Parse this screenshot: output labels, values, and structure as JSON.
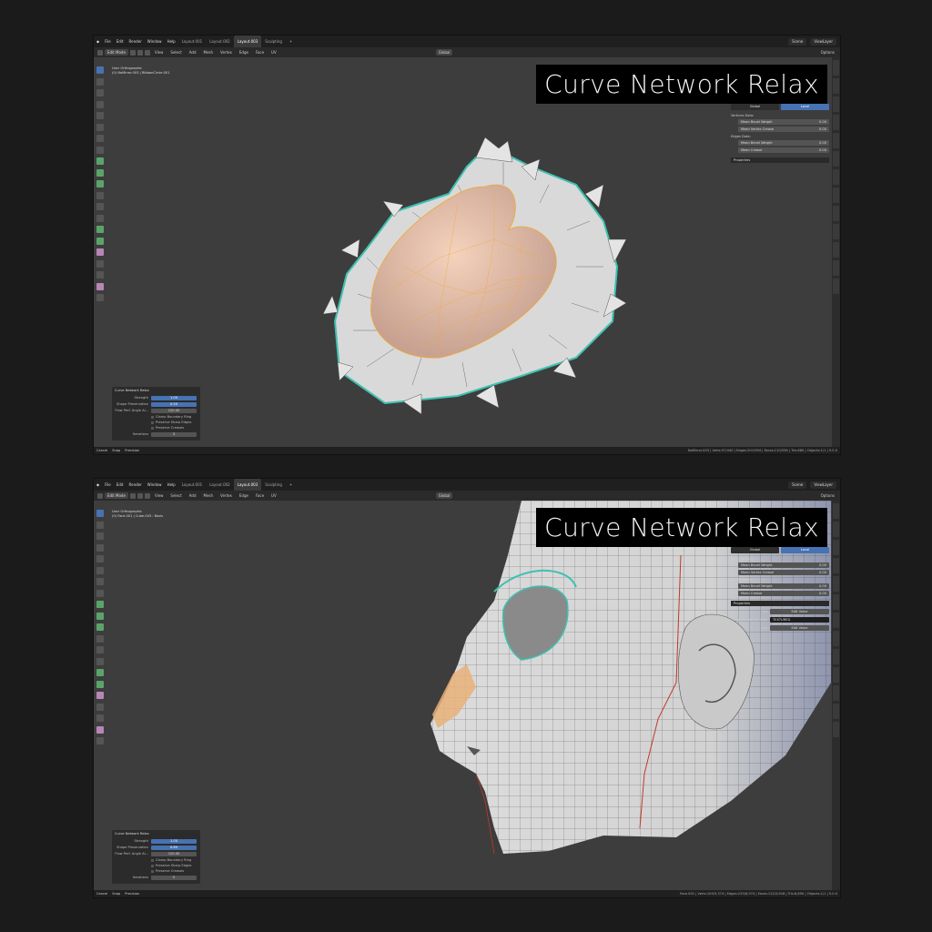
{
  "windows": [
    {
      "menu": [
        "File",
        "Edit",
        "Render",
        "Window",
        "Help"
      ],
      "workspaces": [
        "Layout.001",
        "Layout.002",
        "Layout.003",
        "Sculpting",
        "+"
      ],
      "active_workspace": "Layout.003",
      "scene": "Scene",
      "view_layer": "ViewLayer",
      "mode": "Edit Mode",
      "header_items": [
        "View",
        "Select",
        "Add",
        "Mesh",
        "Vertex",
        "Edge",
        "Face",
        "UV"
      ],
      "transform": "Global",
      "options": "Options",
      "view_name": "User Orthographic",
      "object_info": "(0) NoMirror.003 | RibbonCircle.001",
      "overlay_title": "Curve Network Relax",
      "npanel": {
        "tabs": [
          "Global",
          "Local"
        ],
        "vertices_label": "Vertices Data:",
        "vertex_rows": [
          {
            "k": "Mean Bevel Weight",
            "v": "0.00"
          },
          {
            "k": "Mean Vertex Crease",
            "v": "0.00"
          }
        ],
        "edges_label": "Edges Data:",
        "edge_rows": [
          {
            "k": "Mean Bevel Weight",
            "v": "0.00"
          },
          {
            "k": "Mean Crease",
            "v": "0.00"
          }
        ],
        "properties_label": "Properties",
        "props": []
      },
      "redo": {
        "title": "Curve Network Relax",
        "rows": [
          {
            "k": "Strength",
            "v": "1.00"
          },
          {
            "k": "Shape Preservation",
            "v": "0.50"
          },
          {
            "k": "Flow Perf. Angle Al...",
            "v": "120.00"
          }
        ],
        "checks": [
          "Clamp Boundary Ring",
          "Preserve Sharp Edges",
          "Preserve Creases"
        ],
        "iter_label": "Iterations",
        "iter_value": "3"
      },
      "status_left": [
        "Cancel",
        "Snap",
        "Precision"
      ],
      "status_right": "NoMirror.003 | Verts:97/440 | Edges:201/994 | Faces:110/556 | Tris:880 | Objects:1/1 | 5.0.0"
    },
    {
      "menu": [
        "File",
        "Edit",
        "Render",
        "Window",
        "Help"
      ],
      "workspaces": [
        "Layout.001",
        "Layout.002",
        "Layout.003",
        "Sculpting",
        "+"
      ],
      "active_workspace": "Layout.003",
      "scene": "Scene",
      "view_layer": "ViewLayer",
      "mode": "Edit Mode",
      "header_items": [
        "View",
        "Select",
        "Add",
        "Mesh",
        "Vertex",
        "Edge",
        "Face",
        "UV"
      ],
      "transform": "Global",
      "options": "Options",
      "view_name": "User Orthographic",
      "object_info": "(0) Face.001 | Cube.003 : Basis",
      "overlay_title": "Curve Network Relax",
      "npanel": {
        "tabs": [
          "Global",
          "Local"
        ],
        "vertices_label": "Vertices Data:",
        "vertex_rows": [
          {
            "k": "Mean Bevel Weight",
            "v": "0.00"
          },
          {
            "k": "Mean Vertex Crease",
            "v": "0.00"
          }
        ],
        "edges_label": "Edges Data:",
        "edge_rows": [
          {
            "k": "Mean Bevel Weight",
            "v": "0.00"
          },
          {
            "k": "Mean Crease",
            "v": "0.00"
          }
        ],
        "properties_label": "Properties",
        "props": [
          {
            "k": "ob",
            "v": "Edit Value"
          },
          {
            "k": "prev_display_type",
            "v": "TEXTURED"
          },
          {
            "k": "spa",
            "v": "Edit Value"
          }
        ]
      },
      "redo": {
        "title": "Curve Network Relax",
        "rows": [
          {
            "k": "Strength",
            "v": "1.00"
          },
          {
            "k": "Shape Preservation",
            "v": "0.80"
          },
          {
            "k": "Flow Perf. Angle Al...",
            "v": "120.00"
          }
        ],
        "checks": [
          "Clamp Boundary Ring",
          "Preserve Sharp Edges",
          "Preserve Creases"
        ],
        "iter_label": "Iterations",
        "iter_value": "5"
      },
      "status_left": [
        "Cancel",
        "Snap",
        "Precision"
      ],
      "status_right": "Face.001 | Verts:109/3,374 | Edges:229/6,974 | Faces:122/3,618 | Tris:6,890 | Objects:1/1 | 5.0.0"
    }
  ],
  "colors": {
    "accent": "#4772b3",
    "skin": "#e6b69a",
    "mesh": "#d8d8d8",
    "selection": "#f0a830",
    "boundary": "#3fc1b0"
  }
}
